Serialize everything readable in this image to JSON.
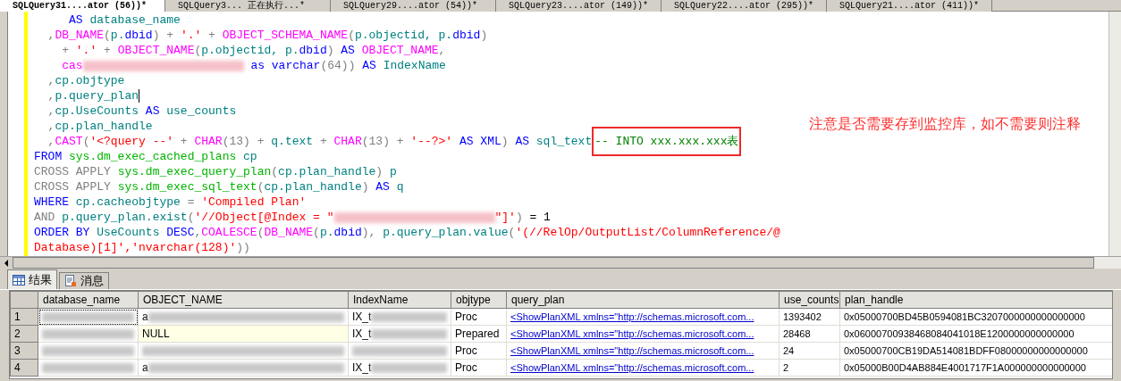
{
  "document_tabs": [
    {
      "label": "SQLQuery31....ator (56))*",
      "selected": true
    },
    {
      "label": "SQLQuery3... 正在执行...*",
      "selected": false
    },
    {
      "label": "SQLQuery29....ator (54))*",
      "selected": false
    },
    {
      "label": "SQLQuery23....ator (149))*",
      "selected": false
    },
    {
      "label": "SQLQuery22....ator (295))*",
      "selected": false
    },
    {
      "label": "SQLQuery21....ator (411))*",
      "selected": false
    }
  ],
  "editor": {
    "lines": [
      [
        {
          "kind": "keyword",
          "text": "     AS"
        },
        {
          "kind": "identifier",
          "text": " database_name"
        }
      ],
      [
        {
          "kind": "operator",
          "text": "  ,"
        },
        {
          "kind": "function",
          "text": "DB_NAME"
        },
        {
          "kind": "operator",
          "text": "("
        },
        {
          "kind": "identifier",
          "text": "p."
        },
        {
          "kind": "keyword",
          "text": "dbid"
        },
        {
          "kind": "operator",
          "text": ") + "
        },
        {
          "kind": "string",
          "text": "'.'"
        },
        {
          "kind": "operator",
          "text": " + "
        },
        {
          "kind": "function",
          "text": "OBJECT_SCHEMA_NAME"
        },
        {
          "kind": "operator",
          "text": "("
        },
        {
          "kind": "identifier",
          "text": "p.objectid, p."
        },
        {
          "kind": "keyword",
          "text": "dbid"
        },
        {
          "kind": "operator",
          "text": ")"
        }
      ],
      [
        {
          "kind": "operator",
          "text": "    + "
        },
        {
          "kind": "string",
          "text": "'.'"
        },
        {
          "kind": "operator",
          "text": " + "
        },
        {
          "kind": "function",
          "text": "OBJECT_NAME"
        },
        {
          "kind": "operator",
          "text": "("
        },
        {
          "kind": "identifier",
          "text": "p.objectid, p."
        },
        {
          "kind": "keyword",
          "text": "dbid"
        },
        {
          "kind": "operator",
          "text": ") "
        },
        {
          "kind": "keyword",
          "text": "AS "
        },
        {
          "kind": "function",
          "text": "OBJECT_NAME"
        },
        {
          "kind": "operator",
          "text": ","
        }
      ],
      [
        {
          "kind": "function",
          "text": "    cas"
        },
        {
          "kind": "redacted"
        },
        {
          "kind": "keyword",
          "text": " as varchar"
        },
        {
          "kind": "operator",
          "text": "(64)) "
        },
        {
          "kind": "keyword",
          "text": "AS "
        },
        {
          "kind": "identifier",
          "text": "IndexName"
        }
      ],
      [
        {
          "kind": "operator",
          "text": "  ,"
        },
        {
          "kind": "identifier",
          "text": "cp.objtype"
        }
      ],
      [
        {
          "kind": "operator",
          "text": "  ,"
        },
        {
          "kind": "identifier",
          "text": "p.query_plan"
        },
        {
          "kind": "cursor"
        }
      ],
      [
        {
          "kind": "operator",
          "text": "  ,"
        },
        {
          "kind": "identifier",
          "text": "cp.UseCounts "
        },
        {
          "kind": "keyword",
          "text": "AS "
        },
        {
          "kind": "identifier",
          "text": "use_counts"
        }
      ],
      [
        {
          "kind": "operator",
          "text": "  ,"
        },
        {
          "kind": "identifier",
          "text": "cp.plan_handle"
        }
      ],
      [
        {
          "kind": "operator",
          "text": "  ,"
        },
        {
          "kind": "function",
          "text": "CAST"
        },
        {
          "kind": "operator",
          "text": "("
        },
        {
          "kind": "string",
          "text": "'<?query --'"
        },
        {
          "kind": "operator",
          "text": " + "
        },
        {
          "kind": "function",
          "text": "CHAR"
        },
        {
          "kind": "operator",
          "text": "(13) + "
        },
        {
          "kind": "identifier",
          "text": "q.text"
        },
        {
          "kind": "operator",
          "text": " + "
        },
        {
          "kind": "function",
          "text": "CHAR"
        },
        {
          "kind": "operator",
          "text": "(13) + "
        },
        {
          "kind": "string",
          "text": "'--?>'"
        },
        {
          "kind": "keyword",
          "text": " AS XML"
        },
        {
          "kind": "operator",
          "text": ") "
        },
        {
          "kind": "keyword",
          "text": "AS "
        },
        {
          "kind": "identifier",
          "text": "sql_text"
        },
        {
          "kind": "highlighted_comment",
          "text": "-- INTO xxx.xxx.xxx表"
        }
      ],
      [
        {
          "kind": "keyword",
          "text": "FROM "
        },
        {
          "kind": "system",
          "text": "sys.dm_exec_cached_plans "
        },
        {
          "kind": "identifier",
          "text": "cp"
        }
      ],
      [
        {
          "kind": "operator",
          "text": "CROSS APPLY "
        },
        {
          "kind": "system",
          "text": "sys.dm_exec_query_plan"
        },
        {
          "kind": "operator",
          "text": "("
        },
        {
          "kind": "identifier",
          "text": "cp.plan_handle"
        },
        {
          "kind": "operator",
          "text": ") "
        },
        {
          "kind": "identifier",
          "text": "p"
        }
      ],
      [
        {
          "kind": "operator",
          "text": "CROSS APPLY "
        },
        {
          "kind": "system",
          "text": "sys.dm_exec_sql_text"
        },
        {
          "kind": "operator",
          "text": "("
        },
        {
          "kind": "identifier",
          "text": "cp.plan_handle"
        },
        {
          "kind": "operator",
          "text": ") "
        },
        {
          "kind": "keyword",
          "text": "AS "
        },
        {
          "kind": "identifier",
          "text": "q"
        }
      ],
      [
        {
          "kind": "keyword",
          "text": "WHERE "
        },
        {
          "kind": "identifier",
          "text": "cp.cacheobjtype "
        },
        {
          "kind": "operator",
          "text": "= "
        },
        {
          "kind": "string",
          "text": "'Compiled Plan'"
        }
      ],
      [
        {
          "kind": "operator",
          "text": "AND "
        },
        {
          "kind": "identifier",
          "text": "p.query_plan.exist"
        },
        {
          "kind": "operator",
          "text": "("
        },
        {
          "kind": "string",
          "text": "'//Object[@Index = \""
        },
        {
          "kind": "redacted"
        },
        {
          "kind": "string",
          "text": "\"]'"
        },
        {
          "kind": "operator",
          "text": ") "
        },
        {
          "kind": "plain",
          "text": "= 1"
        }
      ],
      [
        {
          "kind": "keyword",
          "text": "ORDER BY "
        },
        {
          "kind": "identifier",
          "text": "UseCounts "
        },
        {
          "kind": "keyword",
          "text": "DESC"
        },
        {
          "kind": "operator",
          "text": ","
        },
        {
          "kind": "function",
          "text": "COALESCE"
        },
        {
          "kind": "operator",
          "text": "("
        },
        {
          "kind": "function",
          "text": "DB_NAME"
        },
        {
          "kind": "operator",
          "text": "("
        },
        {
          "kind": "identifier",
          "text": "p."
        },
        {
          "kind": "keyword",
          "text": "dbid"
        },
        {
          "kind": "operator",
          "text": "), "
        },
        {
          "kind": "identifier",
          "text": "p.query_plan.value"
        },
        {
          "kind": "operator",
          "text": "("
        },
        {
          "kind": "string",
          "text": "'(//RelOp/OutputList/ColumnReference/@"
        }
      ],
      [
        {
          "kind": "string",
          "text": "Database)[1]','nvarchar(128)'"
        },
        {
          "kind": "operator",
          "text": "))"
        }
      ]
    ],
    "annotation": "注意是否需要存到监控库，如不需要则注释"
  },
  "result_tabs": [
    {
      "label": "结果",
      "kind": "grid",
      "selected": true
    },
    {
      "label": "消息",
      "kind": "messages",
      "selected": false
    }
  ],
  "grid": {
    "columns": [
      "database_name",
      "OBJECT_NAME",
      "IndexName",
      "objtype",
      "query_plan",
      "use_counts",
      "plan_handle"
    ],
    "rows": [
      {
        "number": "1",
        "selected": true,
        "cells": [
          {
            "kind": "redacted"
          },
          {
            "kind": "partly_redacted",
            "text": "a"
          },
          {
            "kind": "partly_redacted",
            "text": "IX_t"
          },
          {
            "kind": "text",
            "text": "Proc"
          },
          {
            "kind": "link",
            "text": "<ShowPlanXML xmlns=\"http://schemas.microsoft.com..."
          },
          {
            "kind": "text",
            "text": "1393402"
          },
          {
            "kind": "text",
            "text": "0x05000700BD45B0594081BC3207000000000000000"
          }
        ]
      },
      {
        "number": "2",
        "selected": false,
        "cells": [
          {
            "kind": "redacted"
          },
          {
            "kind": "null",
            "text": "NULL"
          },
          {
            "kind": "partly_redacted",
            "text": "IX_t"
          },
          {
            "kind": "text",
            "text": "Prepared"
          },
          {
            "kind": "link",
            "text": "<ShowPlanXML xmlns=\"http://schemas.microsoft.com..."
          },
          {
            "kind": "text",
            "text": "28468"
          },
          {
            "kind": "text",
            "text": "0x06000700938468084041018E1200000000000000"
          }
        ]
      },
      {
        "number": "3",
        "selected": false,
        "cells": [
          {
            "kind": "redacted"
          },
          {
            "kind": "redacted"
          },
          {
            "kind": "redacted"
          },
          {
            "kind": "text",
            "text": "Proc"
          },
          {
            "kind": "link",
            "text": "<ShowPlanXML xmlns=\"http://schemas.microsoft.com..."
          },
          {
            "kind": "text",
            "text": "24"
          },
          {
            "kind": "text",
            "text": "0x05000700CB19DA514081BDFF08000000000000000"
          }
        ]
      },
      {
        "number": "4",
        "selected": false,
        "cells": [
          {
            "kind": "redacted"
          },
          {
            "kind": "partly_redacted",
            "text": "a"
          },
          {
            "kind": "partly_redacted",
            "text": "IX_t"
          },
          {
            "kind": "text",
            "text": "Proc"
          },
          {
            "kind": "link",
            "text": "<ShowPlanXML xmlns=\"http://schemas.microsoft.com..."
          },
          {
            "kind": "text",
            "text": "2"
          },
          {
            "kind": "text",
            "text": "0x05000B00D4AB884E4001717F1A000000000000000"
          }
        ]
      }
    ]
  }
}
